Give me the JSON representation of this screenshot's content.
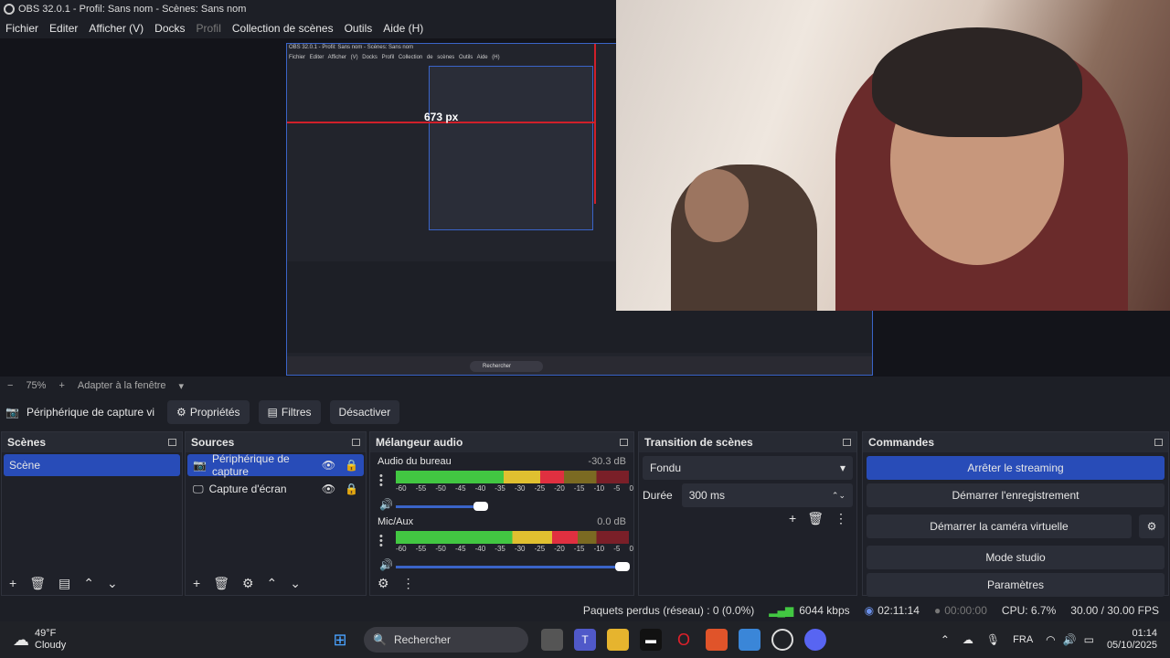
{
  "window": {
    "title": "OBS 32.0.1 - Profil: Sans nom - Scènes: Sans nom"
  },
  "menu": [
    "Fichier",
    "Editer",
    "Afficher (V)",
    "Docks",
    "Profil",
    "Collection de scènes",
    "Outils",
    "Aide (H)"
  ],
  "preview": {
    "nested_title": "OBS 32.0.1 - Profil: Sans nom - Scènes: Sans nom",
    "nested_menu": "Fichier Editer Afficher (V) Docks Profil Collection de scènes Outils Aide (H)",
    "measure_label": "673 px",
    "nested_search": "Rechercher"
  },
  "zoom": {
    "minus": "−",
    "level": "75%",
    "plus": "+",
    "fit": "Adapter à la fenêtre"
  },
  "sourcebar": {
    "device": "Périphérique de capture vi",
    "properties": "Propriétés",
    "filters": "Filtres",
    "deactivate": "Désactiver"
  },
  "scenes": {
    "title": "Scènes",
    "items": [
      "Scène"
    ]
  },
  "sources": {
    "title": "Sources",
    "items": [
      "Périphérique de capture",
      "Capture d'écran"
    ]
  },
  "mixer": {
    "title": "Mélangeur audio",
    "channels": [
      {
        "name": "Audio du bureau",
        "db": "-30.3 dB",
        "level": 0.72,
        "volume": 0.38
      },
      {
        "name": "Mic/Aux",
        "db": "0.0 dB",
        "level": 0.78,
        "volume": 1.0
      }
    ],
    "ticks": [
      "-60",
      "-55",
      "-50",
      "-45",
      "-40",
      "-35",
      "-30",
      "-25",
      "-20",
      "-15",
      "-10",
      "-5",
      "0"
    ]
  },
  "transitions": {
    "title": "Transition de scènes",
    "type": "Fondu",
    "duration_label": "Durée",
    "duration": "300 ms"
  },
  "commands": {
    "title": "Commandes",
    "stop_stream": "Arrêter le streaming",
    "start_record": "Démarrer l'enregistrement",
    "virtual_cam": "Démarrer la caméra virtuelle",
    "studio": "Mode studio",
    "settings": "Paramètres"
  },
  "status": {
    "dropped": "Paquets perdus (réseau) : 0 (0.0%)",
    "bitrate": "6044 kbps",
    "stream_time": "02:11:14",
    "rec_time": "00:00:00",
    "cpu": "CPU: 6.7%",
    "fps": "30.00 / 30.00 FPS"
  },
  "taskbar": {
    "temp": "49°F",
    "weather": "Cloudy",
    "search": "Rechercher",
    "lang": "FRA",
    "time": "01:14",
    "date": "05/10/2025"
  },
  "colors": {
    "accent": "#284cb8",
    "bg": "#1d1f26",
    "red": "#d0202a"
  }
}
